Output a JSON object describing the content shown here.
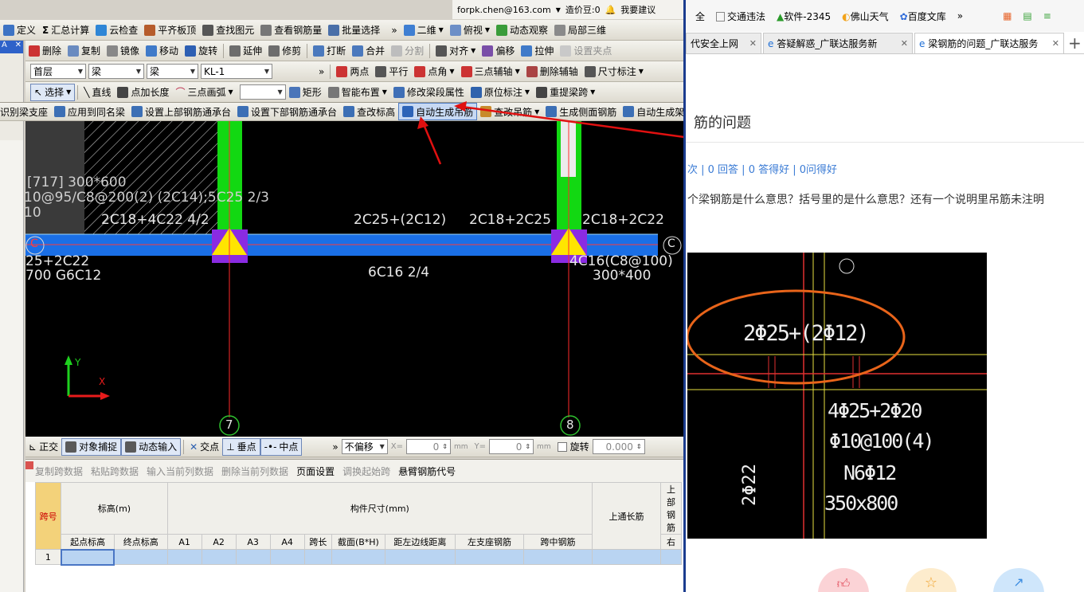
{
  "titlebar": {
    "account": "forpk.chen@163.com",
    "cost_label": "造价豆:0",
    "suggest": "我要建议"
  },
  "toolbar1": {
    "items": [
      "定义",
      "汇总计算",
      "云检查",
      "平齐板顶",
      "查找图元",
      "查看钢筋量",
      "批量选择"
    ],
    "view_mode": "二维",
    "view_dir": "俯视",
    "orbit": "动态观察",
    "local3d": "局部三维"
  },
  "toolbar2": {
    "items": [
      "删除",
      "复制",
      "镜像",
      "移动",
      "旋转",
      "延伸",
      "修剪",
      "打断",
      "合并",
      "分割",
      "对齐",
      "偏移",
      "拉伸",
      "设置夹点"
    ]
  },
  "toolbar3": {
    "floor": "首层",
    "type": "梁",
    "subtype": "梁",
    "name": "KL-1",
    "items": [
      "两点",
      "平行",
      "点角",
      "三点辅轴",
      "删除辅轴",
      "尺寸标注"
    ]
  },
  "toolbar4": {
    "items": [
      "选择",
      "直线",
      "点加长度",
      "三点画弧",
      "矩形",
      "智能布置",
      "修改梁段属性",
      "原位标注",
      "重提梁跨"
    ]
  },
  "toolbar5": {
    "items": [
      "识别梁支座",
      "应用到同名梁",
      "设置上部钢筋通承台",
      "设置下部钢筋通承台",
      "查改标高",
      "自动生成吊筋",
      "查改吊筋",
      "生成侧面钢筋",
      "自动生成架立筋"
    ]
  },
  "cad": {
    "labels": [
      "[717] 300*600",
      "10@95/C8@200(2) (2C14);5C25 2/3",
      "10",
      "2C18+4C22 4/2",
      "2C25+(2C12)",
      "2C18+2C25",
      "2C18+2C22",
      "25+2C22",
      "700 G6C12",
      "6C16 2/4",
      "4C16(C8@100)",
      "300*400"
    ],
    "axis_left": "C",
    "axis_right": "C",
    "grid_a": "7",
    "grid_b": "8",
    "axis_y": "Y",
    "axis_x": "X"
  },
  "statusbar": {
    "items": [
      "正交",
      "对象捕捉",
      "动态输入",
      "交点",
      "垂点",
      "中点"
    ],
    "offset": "不偏移",
    "x_label": "X=",
    "x_val": "0",
    "mm1": "mm",
    "y_label": "Y=",
    "y_val": "0",
    "mm2": "mm",
    "rotate": "旋转",
    "rot_val": "0.000"
  },
  "table_toolbar": {
    "items": [
      "复制跨数据",
      "粘贴跨数据",
      "输入当前列数据",
      "删除当前列数据",
      "页面设置",
      "调换起始跨",
      "悬臂钢筋代号"
    ]
  },
  "table": {
    "h_span": "跨号",
    "h_elev": "标高(m)",
    "h_size": "构件尺寸(mm)",
    "h_top_through": "上通长筋",
    "h_top_rebar": "上部钢筋",
    "cols": [
      "起点标高",
      "终点标高",
      "A1",
      "A2",
      "A3",
      "A4",
      "跨长",
      "截面(B*H)",
      "距左边线距离"
    ],
    "cols2": [
      "左支座钢筋",
      "跨中钢筋",
      "右"
    ],
    "row1": "1"
  },
  "browser": {
    "bookmarks": [
      "全",
      "交通违法",
      "软件-2345",
      "佛山天气",
      "百度文库"
    ],
    "tabs": [
      "代安全上网",
      "答疑解惑_广联达服务新",
      "梁钢筋的问题_广联达服务"
    ],
    "title_tail": "筋的问题",
    "stats": "次 | 0 回答 | 0 答得好 | 0问得好",
    "question": "个梁钢筋是什么意思？括号里的是什么意思？还有一个说明里吊筋未注明",
    "img_labels": [
      "2Φ25+(2Φ12)",
      "4Φ25+2Φ20",
      "Φ10@100(4)",
      "N6Φ12",
      "350x800",
      "2Φ22"
    ]
  }
}
